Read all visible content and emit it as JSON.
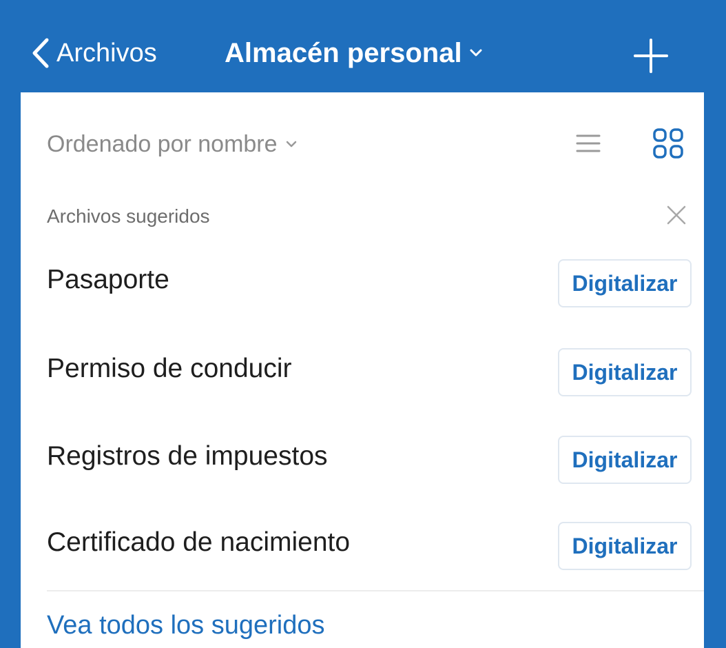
{
  "header": {
    "back_label": "Archivos",
    "title": "Almacén personal"
  },
  "sort": {
    "label": "Ordenado por nombre"
  },
  "suggested": {
    "title": "Archivos sugeridos",
    "items": [
      {
        "label": "Pasaporte",
        "action": "Digitalizar"
      },
      {
        "label": "Permiso de conducir",
        "action": "Digitalizar"
      },
      {
        "label": "Registros de impuestos",
        "action": "Digitalizar"
      },
      {
        "label": "Certificado de nacimiento",
        "action": "Digitalizar"
      }
    ],
    "see_all": "Vea todos los sugeridos"
  },
  "colors": {
    "accent": "#1f6fbd",
    "muted_text": "#8a8a8a",
    "icon_gray": "#9a9a9a"
  },
  "icons": {
    "back": "chevron-left-icon",
    "title_dropdown": "chevron-down-icon",
    "add": "plus-icon",
    "list_view": "list-view-icon",
    "grid_view": "grid-view-icon",
    "close": "close-icon"
  }
}
